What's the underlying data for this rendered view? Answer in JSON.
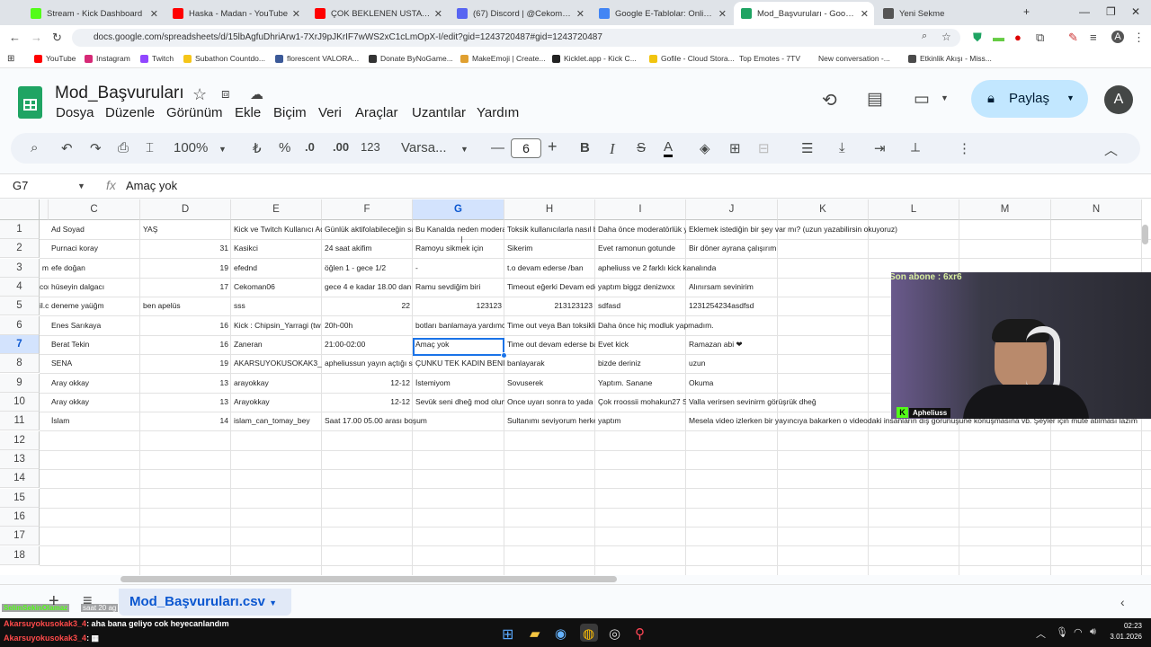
{
  "browser": {
    "tabs": [
      {
        "title": "Stream - Kick Dashboard",
        "color": "#53fc18"
      },
      {
        "title": "Haska - Madan - YouTube",
        "color": "#ff0000"
      },
      {
        "title": "ÇOK BEKLENEN USTA ÇIRAK (M…",
        "color": "#ff0000"
      },
      {
        "title": "(67) Discord | @Cekoman06",
        "color": "#5865f2"
      },
      {
        "title": "Google E-Tablolar: Online E-Tab…",
        "color": "#4285f4"
      },
      {
        "title": "Mod_Başvuruları - Google E-Ta…",
        "color": "#1fa463"
      },
      {
        "title": "Yeni Sekme",
        "color": "#555555"
      }
    ],
    "url": "docs.google.com/spreadsheets/d/15lbAgfuDhriArw1-7XrJ9pJKrIF7wWS2xC1cLmOpX-I/edit?gid=1243720487#gid=1243720487",
    "bookmarks": [
      {
        "label": "YouTube",
        "color": "#ff0000"
      },
      {
        "label": "Instagram",
        "color": "#d62976"
      },
      {
        "label": "Twitch",
        "color": "#9146ff"
      },
      {
        "label": "Subathon Countdo...",
        "color": "#f5c518"
      },
      {
        "label": "florescent VALORA...",
        "color": "#3b5998"
      },
      {
        "label": "Donate ByNoGame...",
        "color": "#333333"
      },
      {
        "label": "MakeEmoji | Create...",
        "color": "#e0a030"
      },
      {
        "label": "Kicklet.app - Kick C...",
        "color": "#222222"
      },
      {
        "label": "Gofile - Cloud Stora...",
        "color": "#f1c40f"
      },
      {
        "label": "Top Emotes - 7TV",
        "color": "#ffffff"
      },
      {
        "label": "New conversation -...",
        "color": "#ffffff"
      },
      {
        "label": "Etkinlik Akışı - Miss...",
        "color": "#4a4a4a"
      }
    ]
  },
  "doc": {
    "title": "Mod_Başvuruları",
    "menus": [
      "Dosya",
      "Düzenle",
      "Görünüm",
      "Ekle",
      "Biçim",
      "Veri",
      "Araçlar",
      "Uzantılar",
      "Yardım"
    ],
    "share_label": "Paylaş",
    "avatar_letter": "A"
  },
  "toolbar": {
    "zoom": "100%",
    "currency": "₺",
    "percent": "%",
    "dec_less": ".0",
    "dec_more": ".00",
    "number_format": "123",
    "font": "Varsa...",
    "font_size": "6",
    "bold": "B",
    "italic": "I",
    "strike": "S",
    "textcolor": "A"
  },
  "formula": {
    "cell_ref": "G7",
    "fx": "fx",
    "value": "Amaç yok"
  },
  "grid": {
    "columns": [
      "C",
      "D",
      "E",
      "F",
      "G",
      "H",
      "I",
      "J",
      "K",
      "L",
      "M",
      "N"
    ],
    "selected_column": "G",
    "rows": [
      "1",
      "2",
      "3",
      "4",
      "5",
      "6",
      "7",
      "8",
      "9",
      "10",
      "11",
      "12",
      "13",
      "14",
      "15",
      "16",
      "17",
      "18"
    ],
    "selected_row": "7",
    "left_clip": [
      "",
      "",
      "m",
      "cor",
      "il.c",
      "",
      "",
      "",
      "",
      "",
      ""
    ],
    "data": [
      [
        "Ad Soyad",
        "YAŞ",
        "Kick ve Twitch Kullanıcı Adı",
        "Günlük aktifolabileceğin saa",
        "Bu Kanalda neden moderat",
        "Toksik kullanıcılarla nasıl ba",
        "Daha önce moderatörlük ya",
        "Eklemek istediğin bir şey var mı? (uzun yazabilirsin okuyoruz)"
      ],
      [
        "Purnaci koray",
        "31",
        "Kasikci",
        "24 saat akifim",
        "Ramoyu sikmek için",
        "Sikerim",
        "Evet ramonun gotunde",
        "Bir döner ayrana çalışırım"
      ],
      [
        "efe doğan",
        "19",
        "efednd",
        "öğlen 1 - gece 1/2",
        "-",
        "t.o devam ederse /ban",
        "apheliuss ve 2 farklı kick kanalında",
        ""
      ],
      [
        "hüseyin dalgacı",
        "17",
        "Cekoman06",
        "gece 4 e kadar 18.00 dan",
        "Ramu sevdiğim biri",
        "Timeout eğerki Devam eder",
        "yaptım biggz denizwxx",
        "Alınırsam sevinirim"
      ],
      [
        "deneme yaüğm",
        "ben apelüs",
        "sss",
        "22",
        "123123",
        "213123123",
        "sdfasd",
        "1231254234asdfsd"
      ],
      [
        "Enes Sarıkaya",
        "16",
        "Kick : Chipsin_Yarragi (tw h",
        "20h-00h",
        "botları banlamaya yardımcı",
        "Time out veya Ban toksikliği",
        "Daha önce hiç modluk yapmadım.",
        ""
      ],
      [
        "Berat Tekin",
        "16",
        "Zaneran",
        "21:00-02:00",
        "Amaç yok",
        "Time out devam ederse ban",
        "Evet kick",
        "Ramazan abi ❤"
      ],
      [
        "SENA",
        "19",
        "AKARSUYOKUSOKAK3_4",
        "apheliussun yayın açtığı saa",
        "ÇUNKU TEK KADIN BENIM",
        "banlayarak",
        "bizde deriniz",
        "uzun"
      ],
      [
        "Aray okkay",
        "13",
        "arayokkay",
        "12-12",
        "İstemiyom",
        "Sovuserek",
        "Yaptım. Sanane",
        "Okuma"
      ],
      [
        "Aray okkay",
        "13",
        "Arayokkay",
        "12-12",
        "Sevük seni dheğ mod olunc",
        "Once uyarı sonra to yada d",
        "Çok rroossii mohakun27 SE",
        "Valla verirsen sevinirm görüşrük dheğ"
      ],
      [
        "İslam",
        "14",
        "islam_can_tomay_bey",
        "Saat 17.00 05.00 arası boşum",
        "",
        "Sultanımı seviyorum herkes",
        "yaptım",
        "Mesela video izlerken bir yayıncıya bakarken o videodaki insanların dış görünüşüne konuşmasına vb. Şeyler için mute atılması lazım"
      ]
    ]
  },
  "sheet": {
    "name": "Mod_Başvuruları.csv"
  },
  "overlay": {
    "last_sub": "Son abone : 6xr6",
    "cam_user": "Apheliuss",
    "follower_note": "SelimSekinOlamaz",
    "follower_time": "saat 20 ag",
    "chat": [
      {
        "user": "Akarsuyokusokak3_4",
        "message": ": aha bana geliyo cok heyecanlandım"
      },
      {
        "user": "Akarsuyokusokak3_4",
        "message": ": ▦"
      }
    ]
  },
  "taskbar": {
    "time": "02:23",
    "date": "3.01.2026"
  }
}
